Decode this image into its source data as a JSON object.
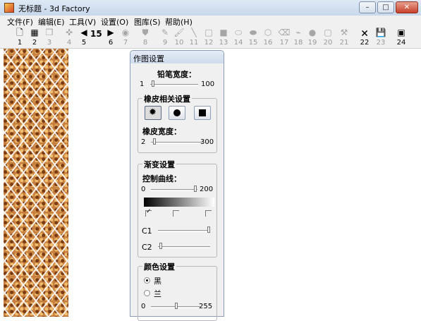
{
  "window": {
    "title": "无标题 - 3d Factory",
    "min": "–",
    "max": "□",
    "close": "✕"
  },
  "menu": [
    "文件(F)",
    "编辑(E)",
    "工具(V)",
    "设置(O)",
    "图库(S)",
    "帮助(H)"
  ],
  "toolbar": {
    "brush_count": "15",
    "tools": [
      {
        "num": "1",
        "icon": "new-file-icon",
        "glyph": "🗋",
        "enabled": true
      },
      {
        "num": "2",
        "icon": "grid-icon",
        "glyph": "▦",
        "enabled": true
      },
      {
        "num": "3",
        "icon": "copy-icon",
        "glyph": "❐",
        "enabled": false
      },
      {
        "num": "4",
        "icon": "pick-icon",
        "glyph": "✜",
        "enabled": false
      },
      {
        "num": "5",
        "icon": "prev-arrow-icon",
        "glyph": "◀",
        "enabled": true
      },
      {
        "num": "6",
        "icon": "next-arrow-icon",
        "glyph": "▶",
        "enabled": true
      },
      {
        "num": "7",
        "icon": "eye-icon",
        "glyph": "◉",
        "enabled": false
      },
      {
        "num": "8",
        "icon": "bucket-icon",
        "glyph": "⛊",
        "enabled": false
      },
      {
        "num": "9",
        "icon": "pencil-icon",
        "glyph": "✎",
        "enabled": false
      },
      {
        "num": "10",
        "icon": "brush-icon",
        "glyph": "🖌",
        "enabled": false
      },
      {
        "num": "11",
        "icon": "line-icon",
        "glyph": "╲",
        "enabled": false
      },
      {
        "num": "12",
        "icon": "rectangle-icon",
        "glyph": "□",
        "enabled": false
      },
      {
        "num": "13",
        "icon": "filled-rect-icon",
        "glyph": "■",
        "enabled": false
      },
      {
        "num": "14",
        "icon": "ellipse-icon",
        "glyph": "⬭",
        "enabled": false
      },
      {
        "num": "15",
        "icon": "filled-ellipse-icon",
        "glyph": "⬬",
        "enabled": false
      },
      {
        "num": "16",
        "icon": "polygon-icon",
        "glyph": "⬡",
        "enabled": false
      },
      {
        "num": "17",
        "icon": "eraser-icon",
        "glyph": "⌫",
        "enabled": false
      },
      {
        "num": "18",
        "icon": "lasso-icon",
        "glyph": "⌁",
        "enabled": false
      },
      {
        "num": "19",
        "icon": "circle-icon",
        "glyph": "●",
        "enabled": false
      },
      {
        "num": "20",
        "icon": "square-outline-icon",
        "glyph": "▢",
        "enabled": false
      },
      {
        "num": "21",
        "icon": "wand-icon",
        "glyph": "⚒",
        "enabled": false
      },
      {
        "num": "22",
        "icon": "delete-icon",
        "glyph": "🗙",
        "enabled": true
      },
      {
        "num": "23",
        "icon": "save-icon",
        "glyph": "💾",
        "enabled": false
      },
      {
        "num": "24",
        "icon": "gallery-icon",
        "glyph": "▣",
        "enabled": true
      }
    ]
  },
  "panel": {
    "title": "作图设置",
    "pencil_width_label": "铅笔宽度：",
    "pencil_min": "1",
    "pencil_max": "100",
    "pencil_value": 1,
    "eraser_group": "橡皮相关设置",
    "eraser_width_label": "橡皮宽度：",
    "eraser_min": "2",
    "eraser_max": "300",
    "eraser_value": 2,
    "gradient_group": "渐变设置",
    "curve_label": "控制曲线：",
    "curve_min": "0",
    "curve_max": "200",
    "curve_value": 200,
    "c1_label": "C1",
    "c1_value": 1.0,
    "c2_label": "C2",
    "c2_value": 0.0,
    "color_group": "颜色设置",
    "radio_black": "黑",
    "radio_blue": "兰",
    "color_min": "0",
    "color_max": "255",
    "color_value": 0.45
  }
}
